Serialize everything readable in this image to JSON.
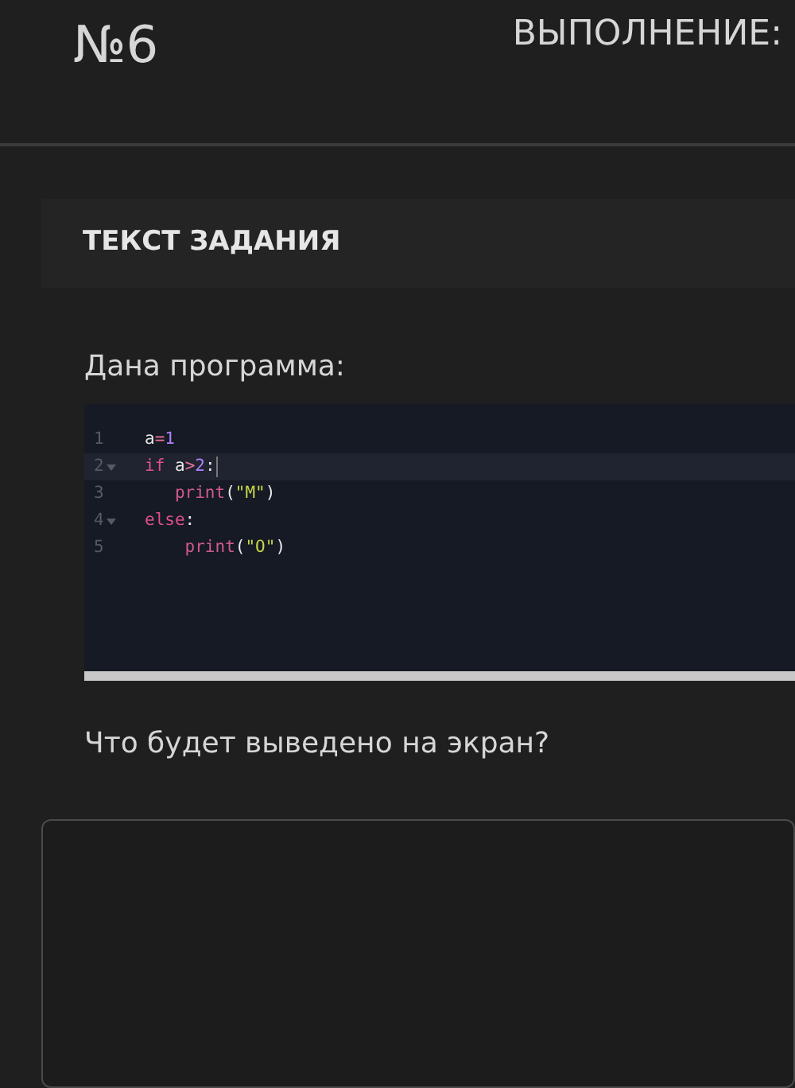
{
  "header": {
    "task_number": "№6",
    "status_label": "ВЫПОЛНЕНИЕ:"
  },
  "task": {
    "title": "ТЕКСТ ЗАДАНИЯ",
    "intro": "Дана программа:",
    "code": [
      {
        "number": "1",
        "fold": false,
        "active": false,
        "tokens": [
          {
            "kind": "plain",
            "text": "a"
          },
          {
            "kind": "op",
            "text": "="
          },
          {
            "kind": "number",
            "text": "1"
          }
        ]
      },
      {
        "number": "2",
        "fold": true,
        "active": true,
        "tokens": [
          {
            "kind": "keyword",
            "text": "if"
          },
          {
            "kind": "plain",
            "text": " a"
          },
          {
            "kind": "op",
            "text": ">"
          },
          {
            "kind": "number",
            "text": "2"
          },
          {
            "kind": "plain",
            "text": ":"
          }
        ]
      },
      {
        "number": "3",
        "fold": false,
        "active": false,
        "tokens": [
          {
            "kind": "func",
            "text": "   print"
          },
          {
            "kind": "plain",
            "text": "("
          },
          {
            "kind": "string",
            "text": "\"M\""
          },
          {
            "kind": "plain",
            "text": ")"
          }
        ]
      },
      {
        "number": "4",
        "fold": true,
        "active": false,
        "tokens": [
          {
            "kind": "keyword",
            "text": "else"
          },
          {
            "kind": "plain",
            "text": ":"
          }
        ]
      },
      {
        "number": "5",
        "fold": false,
        "active": false,
        "tokens": [
          {
            "kind": "func",
            "text": "    print"
          },
          {
            "kind": "plain",
            "text": "("
          },
          {
            "kind": "string",
            "text": "\"O\""
          },
          {
            "kind": "plain",
            "text": ")"
          }
        ]
      }
    ],
    "question": "Что будет выведено на экран?"
  }
}
